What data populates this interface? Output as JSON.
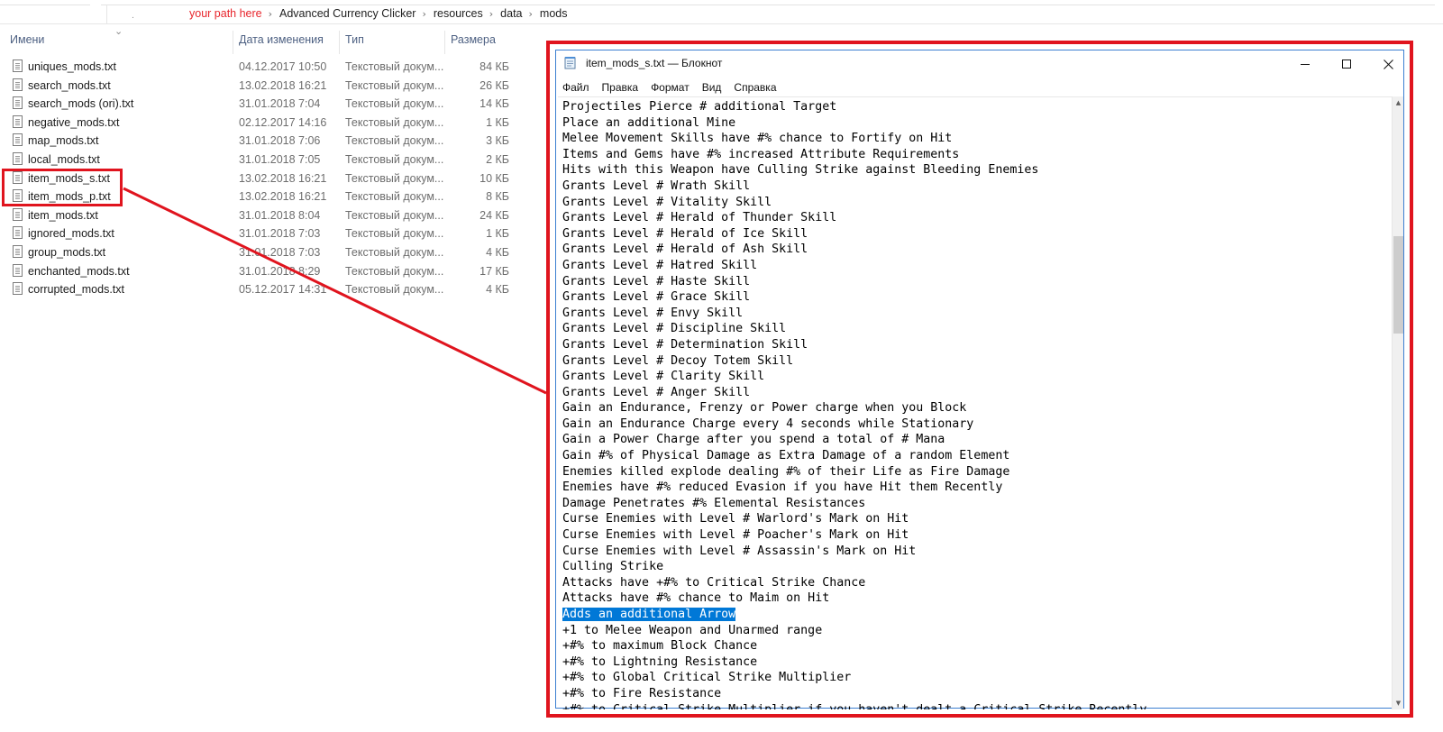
{
  "explorer": {
    "path": [
      {
        "label": "your path here",
        "red": true
      },
      {
        "label": "Advanced Currency Clicker",
        "red": false
      },
      {
        "label": "resources",
        "red": false
      },
      {
        "label": "data",
        "red": false
      },
      {
        "label": "mods",
        "red": false
      }
    ],
    "columns": {
      "name": "Имени",
      "date": "Дата изменения",
      "type": "Тип",
      "size": "Размера"
    },
    "files": [
      {
        "name": "uniques_mods.txt",
        "date": "04.12.2017 10:50",
        "type": "Текстовый докум...",
        "size": "84 КБ"
      },
      {
        "name": "search_mods.txt",
        "date": "13.02.2018 16:21",
        "type": "Текстовый докум...",
        "size": "26 КБ"
      },
      {
        "name": "search_mods (ori).txt",
        "date": "31.01.2018 7:04",
        "type": "Текстовый докум...",
        "size": "14 КБ"
      },
      {
        "name": "negative_mods.txt",
        "date": "02.12.2017 14:16",
        "type": "Текстовый докум...",
        "size": "1 КБ"
      },
      {
        "name": "map_mods.txt",
        "date": "31.01.2018 7:06",
        "type": "Текстовый докум...",
        "size": "3 КБ"
      },
      {
        "name": "local_mods.txt",
        "date": "31.01.2018 7:05",
        "type": "Текстовый докум...",
        "size": "2 КБ"
      },
      {
        "name": "item_mods_s.txt",
        "date": "13.02.2018 16:21",
        "type": "Текстовый докум...",
        "size": "10 КБ"
      },
      {
        "name": "item_mods_p.txt",
        "date": "13.02.2018 16:21",
        "type": "Текстовый докум...",
        "size": "8 КБ"
      },
      {
        "name": "item_mods.txt",
        "date": "31.01.2018 8:04",
        "type": "Текстовый докум...",
        "size": "24 КБ"
      },
      {
        "name": "ignored_mods.txt",
        "date": "31.01.2018 7:03",
        "type": "Текстовый докум...",
        "size": "1 КБ"
      },
      {
        "name": "group_mods.txt",
        "date": "31.01.2018 7:03",
        "type": "Текстовый докум...",
        "size": "4 КБ"
      },
      {
        "name": "enchanted_mods.txt",
        "date": "31.01.2018 8:29",
        "type": "Текстовый докум...",
        "size": "17 КБ"
      },
      {
        "name": "corrupted_mods.txt",
        "date": "05.12.2017 14:31",
        "type": "Текстовый докум...",
        "size": "4 КБ"
      }
    ]
  },
  "callout": {
    "color": "#e0141e"
  },
  "notepad": {
    "title": "item_mods_s.txt — Блокнот",
    "menu": [
      "Файл",
      "Правка",
      "Формат",
      "Вид",
      "Справка"
    ],
    "window_buttons": [
      "minimize-icon",
      "maximize-icon",
      "close-icon"
    ],
    "selection_color": "#0078d7",
    "selected_line_index": 32,
    "lines": [
      "Projectiles Pierce # additional Target",
      "Place an additional Mine",
      "Melee Movement Skills have #% chance to Fortify on Hit",
      "Items and Gems have #% increased Attribute Requirements",
      "Hits with this Weapon have Culling Strike against Bleeding Enemies",
      "Grants Level # Wrath Skill",
      "Grants Level # Vitality Skill",
      "Grants Level # Herald of Thunder Skill",
      "Grants Level # Herald of Ice Skill",
      "Grants Level # Herald of Ash Skill",
      "Grants Level # Hatred Skill",
      "Grants Level # Haste Skill",
      "Grants Level # Grace Skill",
      "Grants Level # Envy Skill",
      "Grants Level # Discipline Skill",
      "Grants Level # Determination Skill",
      "Grants Level # Decoy Totem Skill",
      "Grants Level # Clarity Skill",
      "Grants Level # Anger Skill",
      "Gain an Endurance, Frenzy or Power charge when you Block",
      "Gain an Endurance Charge every 4 seconds while Stationary",
      "Gain a Power Charge after you spend a total of # Mana",
      "Gain #% of Physical Damage as Extra Damage of a random Element",
      "Enemies killed explode dealing #% of their Life as Fire Damage",
      "Enemies have #% reduced Evasion if you have Hit them Recently",
      "Damage Penetrates #% Elemental Resistances",
      "Curse Enemies with Level # Warlord's Mark on Hit",
      "Curse Enemies with Level # Poacher's Mark on Hit",
      "Curse Enemies with Level # Assassin's Mark on Hit",
      "Culling Strike",
      "Attacks have +#% to Critical Strike Chance",
      "Attacks have #% chance to Maim on Hit",
      "Adds an additional Arrow",
      "+1 to Melee Weapon and Unarmed range",
      "+#% to maximum Block Chance",
      "+#% to Lightning Resistance",
      "+#% to Global Critical Strike Multiplier",
      "+#% to Fire Resistance",
      "+#% to Critical Strike Multiplier if you haven't dealt a Critical Strike Recently"
    ]
  }
}
